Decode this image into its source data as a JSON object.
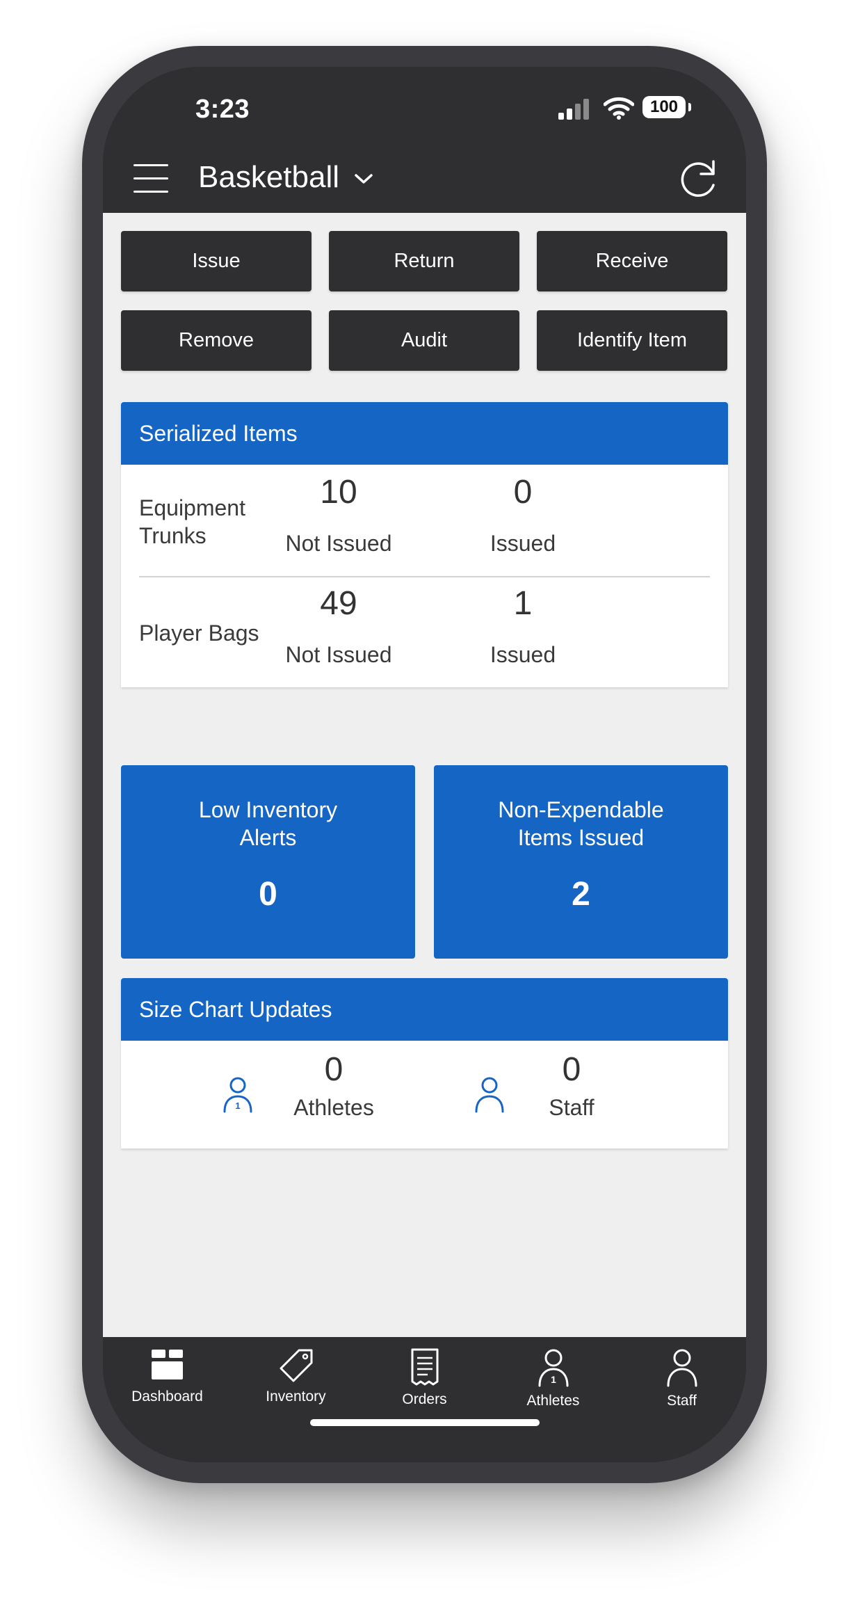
{
  "status_bar": {
    "time": "3:23",
    "battery": "100"
  },
  "header": {
    "title": "Basketball"
  },
  "actions": [
    "Issue",
    "Return",
    "Receive",
    "Remove",
    "Audit",
    "Identify Item"
  ],
  "serialized": {
    "title": "Serialized Items",
    "rows": [
      {
        "label": "Equipment Trunks",
        "not_issued_value": "10",
        "not_issued_label": "Not Issued",
        "issued_value": "0",
        "issued_label": "Issued"
      },
      {
        "label": "Player Bags",
        "not_issued_value": "49",
        "not_issued_label": "Not Issued",
        "issued_value": "1",
        "issued_label": "Issued"
      }
    ]
  },
  "tiles": [
    {
      "label": "Low Inventory Alerts",
      "value": "0"
    },
    {
      "label": "Non-Expendable Items Issued",
      "value": "2"
    }
  ],
  "size_chart": {
    "title": "Size Chart Updates",
    "items": [
      {
        "value": "0",
        "label": "Athletes",
        "icon": "athlete-icon"
      },
      {
        "value": "0",
        "label": "Staff",
        "icon": "staff-icon"
      }
    ]
  },
  "tabs": [
    {
      "label": "Dashboard",
      "icon": "dashboard-icon"
    },
    {
      "label": "Inventory",
      "icon": "tag-icon"
    },
    {
      "label": "Orders",
      "icon": "receipt-icon"
    },
    {
      "label": "Athletes",
      "icon": "athlete-icon"
    },
    {
      "label": "Staff",
      "icon": "person-icon"
    }
  ],
  "colors": {
    "accent": "#1565c5",
    "dark": "#2f2f31",
    "background": "#efefef"
  }
}
